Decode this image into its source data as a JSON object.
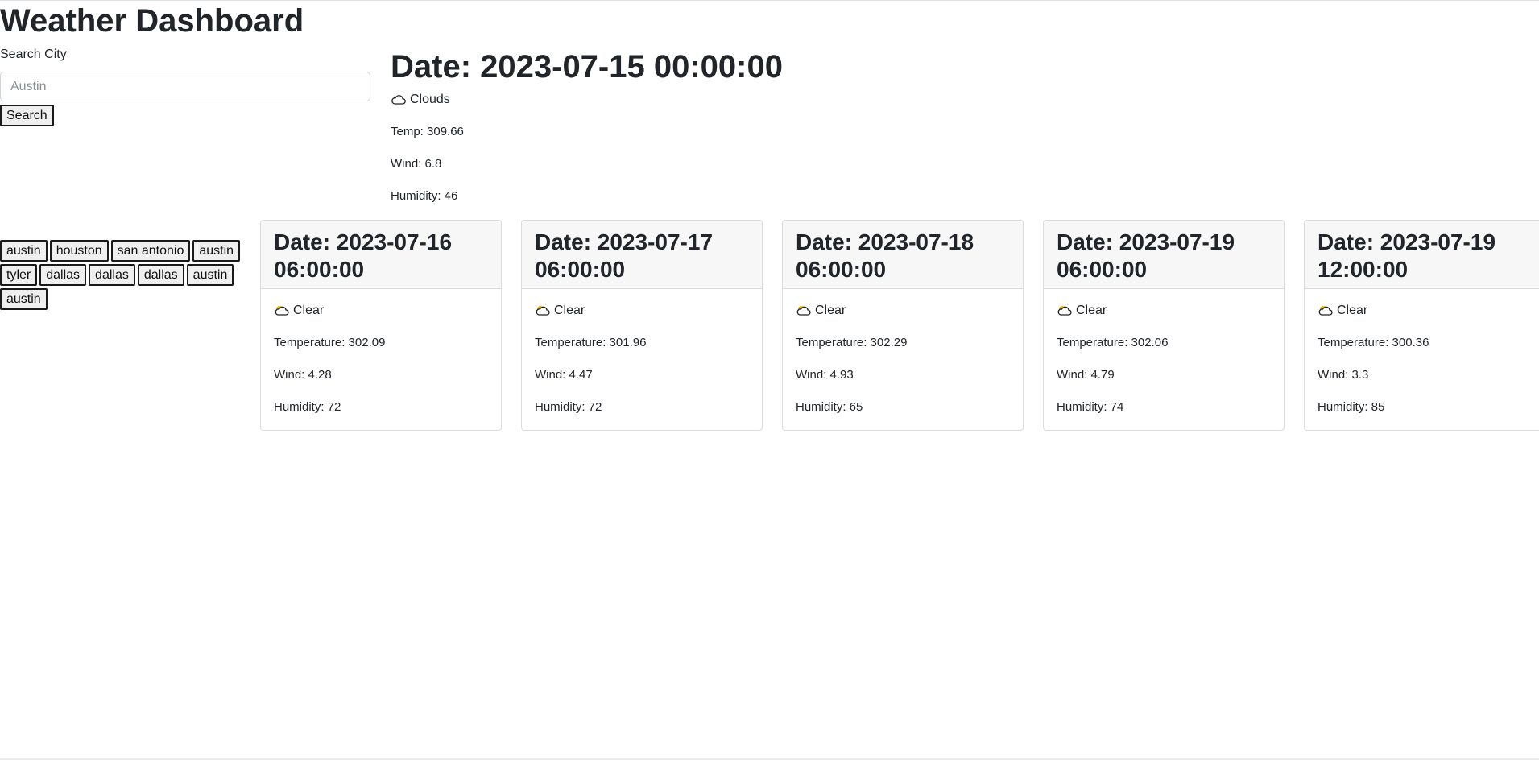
{
  "page": {
    "title": "Weather Dashboard"
  },
  "search": {
    "label": "Search City",
    "value": "",
    "placeholder": "Austin",
    "button_label": "Search"
  },
  "history": [
    "austin",
    "houston",
    "san antonio",
    "austin",
    "tyler",
    "dallas",
    "dallas",
    "dallas",
    "austin",
    "austin"
  ],
  "current": {
    "date": "Date: 2023-07-15 00:00:00",
    "condition": "Clouds",
    "condition_icon": "cloud-icon",
    "temp": "Temp: 309.66",
    "wind": "Wind: 6.8",
    "humidity": "Humidity: 46"
  },
  "forecast": [
    {
      "date": "Date: 2023-07-16 06:00:00",
      "condition": "Clear",
      "condition_icon": "sun-behind-cloud-icon",
      "temperature": "Temperature: 302.09",
      "wind": "Wind: 4.28",
      "humidity": "Humidity: 72"
    },
    {
      "date": "Date: 2023-07-17 06:00:00",
      "condition": "Clear",
      "condition_icon": "sun-behind-cloud-icon",
      "temperature": "Temperature: 301.96",
      "wind": "Wind: 4.47",
      "humidity": "Humidity: 72"
    },
    {
      "date": "Date: 2023-07-18 06:00:00",
      "condition": "Clear",
      "condition_icon": "sun-behind-cloud-icon",
      "temperature": "Temperature: 302.29",
      "wind": "Wind: 4.93",
      "humidity": "Humidity: 65"
    },
    {
      "date": "Date: 2023-07-19 06:00:00",
      "condition": "Clear",
      "condition_icon": "sun-behind-cloud-icon",
      "temperature": "Temperature: 302.06",
      "wind": "Wind: 4.79",
      "humidity": "Humidity: 74"
    },
    {
      "date": "Date: 2023-07-19 12:00:00",
      "condition": "Clear",
      "condition_icon": "sun-behind-cloud-icon",
      "temperature": "Temperature: 300.36",
      "wind": "Wind: 3.3",
      "humidity": "Humidity: 85"
    }
  ],
  "colors": {
    "text": "#212529",
    "card_border": "#dcdcdc",
    "card_header_bg": "#f7f7f7",
    "button_bg": "#efefef",
    "sun": "#f5b400"
  }
}
